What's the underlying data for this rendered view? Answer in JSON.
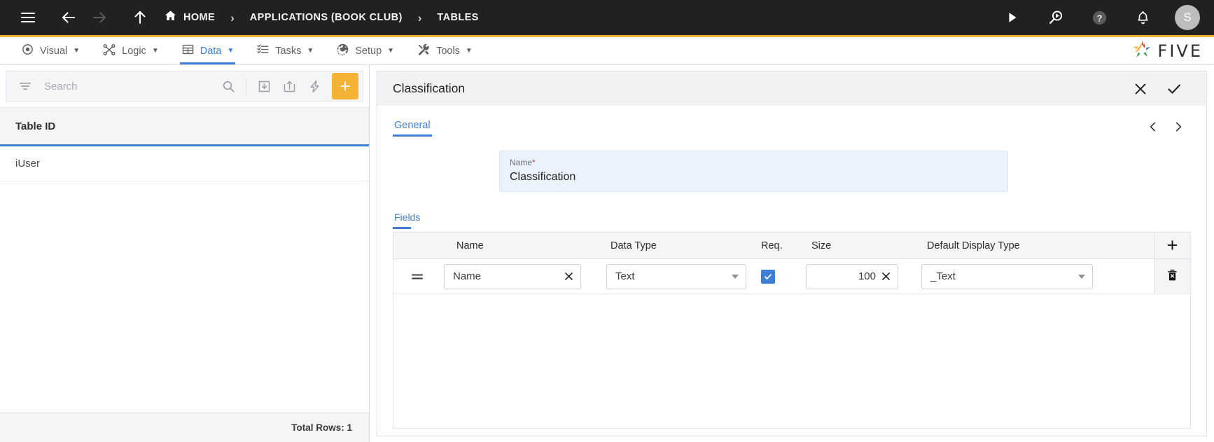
{
  "topbar": {
    "menu_icon": "hamburger-icon",
    "back_icon": "arrow-left-icon",
    "forward_icon": "arrow-right-icon",
    "up_icon": "arrow-up-icon",
    "home_icon": "home-icon",
    "breadcrumbs": [
      {
        "label": "HOME"
      },
      {
        "label": "APPLICATIONS (BOOK CLUB)"
      },
      {
        "label": "TABLES"
      }
    ],
    "separator": "›",
    "actions": [
      {
        "name": "run-icon"
      },
      {
        "name": "search-run-icon"
      },
      {
        "name": "help-icon"
      },
      {
        "name": "notifications-icon"
      }
    ],
    "avatar_initial": "S",
    "accent_bar_color": "#f5b335",
    "background_color": "#212121"
  },
  "menubar": {
    "items": [
      {
        "label": "Visual",
        "icon": "eye-icon",
        "active": false
      },
      {
        "label": "Logic",
        "icon": "logic-graph-icon",
        "active": false
      },
      {
        "label": "Data",
        "icon": "table-grid-icon",
        "active": true
      },
      {
        "label": "Tasks",
        "icon": "checklist-icon",
        "active": false
      },
      {
        "label": "Setup",
        "icon": "gear-icon",
        "active": false
      },
      {
        "label": "Tools",
        "icon": "tools-icon",
        "active": false
      }
    ],
    "caret": "▼",
    "brand": "FIVE",
    "active_color": "#3d7fd6"
  },
  "left_pane": {
    "search": {
      "placeholder": "Search",
      "value": "",
      "filter_icon": "filter-icon",
      "search_icon": "search-icon",
      "import_icon": "import-icon",
      "export_icon": "export-icon",
      "quick_icon": "lightning-icon",
      "add_label": "+"
    },
    "list": {
      "column_header": "Table ID",
      "rows": [
        {
          "table_id": "iUser"
        }
      ],
      "footer": "Total Rows: 1"
    }
  },
  "right_pane": {
    "panel_title": "Classification",
    "close_icon": "close-icon",
    "confirm_icon": "check-icon",
    "tabs": [
      {
        "label": "General",
        "active": true
      }
    ],
    "prev_icon": "chevron-left-icon",
    "next_icon": "chevron-right-icon",
    "prev_label": "‹",
    "next_label": "›",
    "name_field": {
      "label": "Name",
      "required_mark": "*",
      "value": "Classification"
    },
    "fields_section": {
      "tab_label": "Fields",
      "add_row_label": "+",
      "delete_icon": "delete-row-icon",
      "columns": [
        {
          "key": "name",
          "label": "Name"
        },
        {
          "key": "data_type",
          "label": "Data Type"
        },
        {
          "key": "req",
          "label": "Req."
        },
        {
          "key": "size",
          "label": "Size"
        },
        {
          "key": "default_display_type",
          "label": "Default Display Type"
        }
      ],
      "rows": [
        {
          "handle_icon": "drag-handle-icon",
          "name": "Name",
          "name_clear": "✕",
          "data_type": "Text",
          "req": true,
          "size": "100",
          "size_clear": "✕",
          "default_display_type": "_Text"
        }
      ]
    }
  },
  "annotation": {
    "arrow_color": "#e8241a",
    "points_to": "add-field-row-button"
  }
}
